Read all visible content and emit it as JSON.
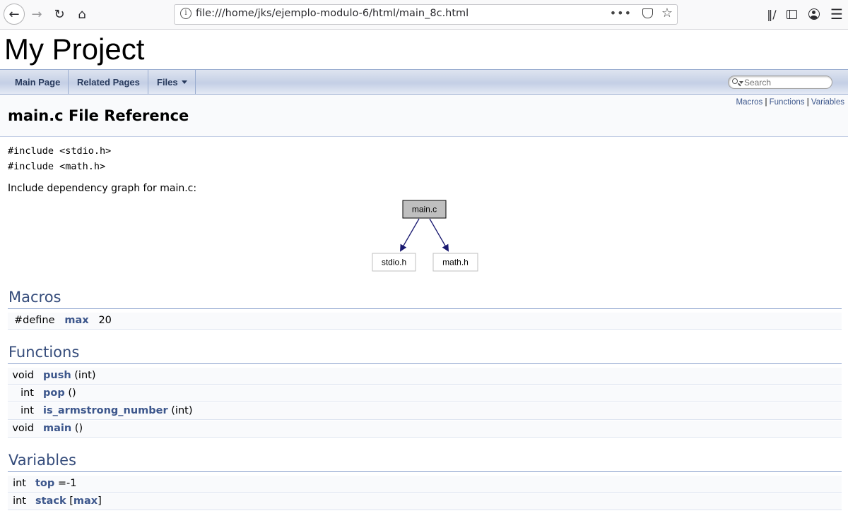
{
  "browser": {
    "url": "file:///home/jks/ejemplo-modulo-6/html/main_8c.html",
    "page_actions": "•••"
  },
  "project": {
    "title": "My Project"
  },
  "nav": {
    "tabs": [
      {
        "label": "Main Page"
      },
      {
        "label": "Related Pages"
      },
      {
        "label": "Files"
      }
    ],
    "search_placeholder": "Search"
  },
  "header": {
    "title": "main.c File Reference",
    "summary_links": [
      "Macros",
      "Functions",
      "Variables"
    ],
    "separator": "|"
  },
  "includes": [
    "#include <stdio.h>",
    "#include <math.h>"
  ],
  "dependency_graph": {
    "caption": "Include dependency graph for main.c:",
    "nodes": {
      "root": "main.c",
      "child1": "stdio.h",
      "child2": "math.h"
    },
    "colors": {
      "root_fill": "#bfbfbf",
      "arrow": "#191970",
      "child_border": "#bfbfbf"
    }
  },
  "macros": {
    "heading": "Macros",
    "rows": [
      {
        "prefix": "#define",
        "name": "max",
        "value": "20"
      }
    ]
  },
  "functions": {
    "heading": "Functions",
    "rows": [
      {
        "type": "void",
        "name": "push",
        "args": "(int)"
      },
      {
        "type": "int",
        "name": "pop",
        "args": "()"
      },
      {
        "type": "int",
        "name": "is_armstrong_number",
        "args": "(int)"
      },
      {
        "type": "void",
        "name": "main",
        "args": "()"
      }
    ]
  },
  "variables": {
    "heading": "Variables",
    "rows": [
      {
        "type": "int",
        "name": "top",
        "suffix": "=-1"
      },
      {
        "type": "int",
        "name": "stack",
        "open": "[",
        "link": "max",
        "close": "]"
      }
    ]
  },
  "colors": {
    "link": "#3d578c",
    "section_heading": "#354c7b",
    "nav_text": "#283a5d"
  }
}
